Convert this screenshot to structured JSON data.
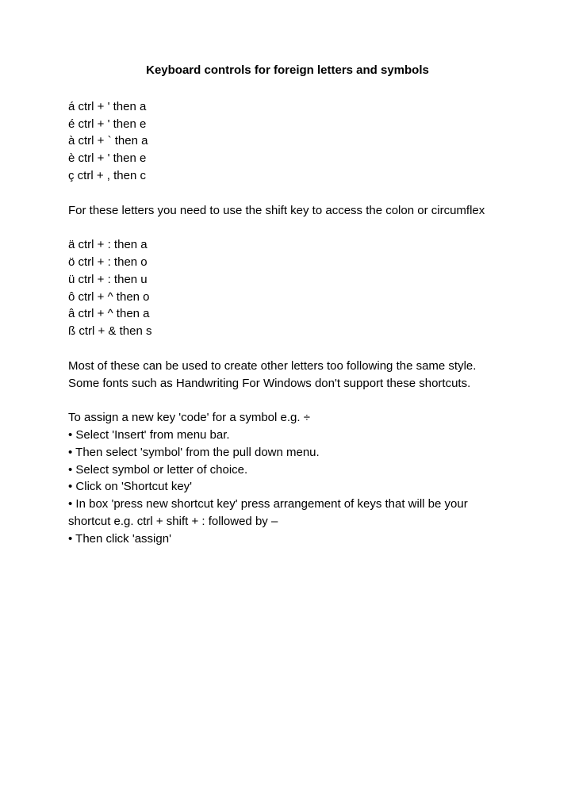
{
  "title": "Keyboard controls for foreign letters and symbols",
  "group1": [
    "á  ctrl + ' then a",
    "é  ctrl + ' then e",
    "à  ctrl + ` then a",
    "è  ctrl + ' then e",
    "ç ctrl + , then c"
  ],
  "para1": "For these letters you need to use the shift key to access the colon or circumflex",
  "group2": [
    "ä  ctrl + : then a",
    "ö ctrl + : then o",
    "ü ctrl + : then u",
    "ô ctrl + ^ then o",
    "â ctrl + ^ then a",
    "ß ctrl + & then s"
  ],
  "para2": "Most of these can be used to create other letters too following the same style. Some fonts such as Handwriting For Windows don't support these shortcuts.",
  "para3": "To assign a new key 'code' for a symbol e.g. ÷",
  "bullets": [
    "Select 'Insert' from menu bar.",
    "Then select 'symbol' from the pull down menu.",
    "Select symbol or letter of choice.",
    "Click on 'Shortcut key'",
    "In box 'press new shortcut key' press arrangement of keys that will be your shortcut e.g. ctrl + shift + : followed by –",
    "Then click 'assign'"
  ]
}
